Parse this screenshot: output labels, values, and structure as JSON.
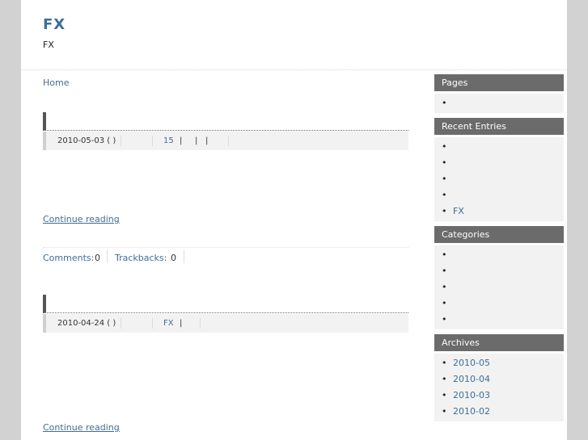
{
  "header": {
    "site_title": "FX",
    "site_description": "FX"
  },
  "breadcrumb": {
    "home_label": "Home"
  },
  "entries": [
    {
      "title": "",
      "date": "2010-05-03 ( )",
      "category_link": "15",
      "separators": [
        "|",
        "|",
        "|"
      ],
      "continue_label": "Continue reading",
      "comments_label": "Comments:",
      "comments_count": "0",
      "trackbacks_label": "Trackbacks:",
      "trackbacks_count": "0"
    },
    {
      "title": "",
      "date": "2010-04-24 ( )",
      "category_link": "FX",
      "separators": [
        "|"
      ],
      "continue_label": "Continue reading"
    }
  ],
  "sidebar": {
    "pages": {
      "title": "Pages",
      "items": [
        ""
      ]
    },
    "recent_entries": {
      "title": "Recent Entries",
      "items": [
        "",
        "",
        "",
        "",
        "FX"
      ]
    },
    "categories": {
      "title": "Categories",
      "items": [
        "",
        "",
        "",
        "",
        ""
      ]
    },
    "archives": {
      "title": "Archives",
      "items": [
        "2010-05",
        "2010-04",
        "2010-03",
        "2010-02"
      ]
    }
  },
  "colors": {
    "background": "#d2d2d2",
    "link": "#3e6e96",
    "widget_title_bg": "#6b6b6b",
    "widget_body_bg": "#f2f2f2"
  },
  "bullet_glyph": "•"
}
